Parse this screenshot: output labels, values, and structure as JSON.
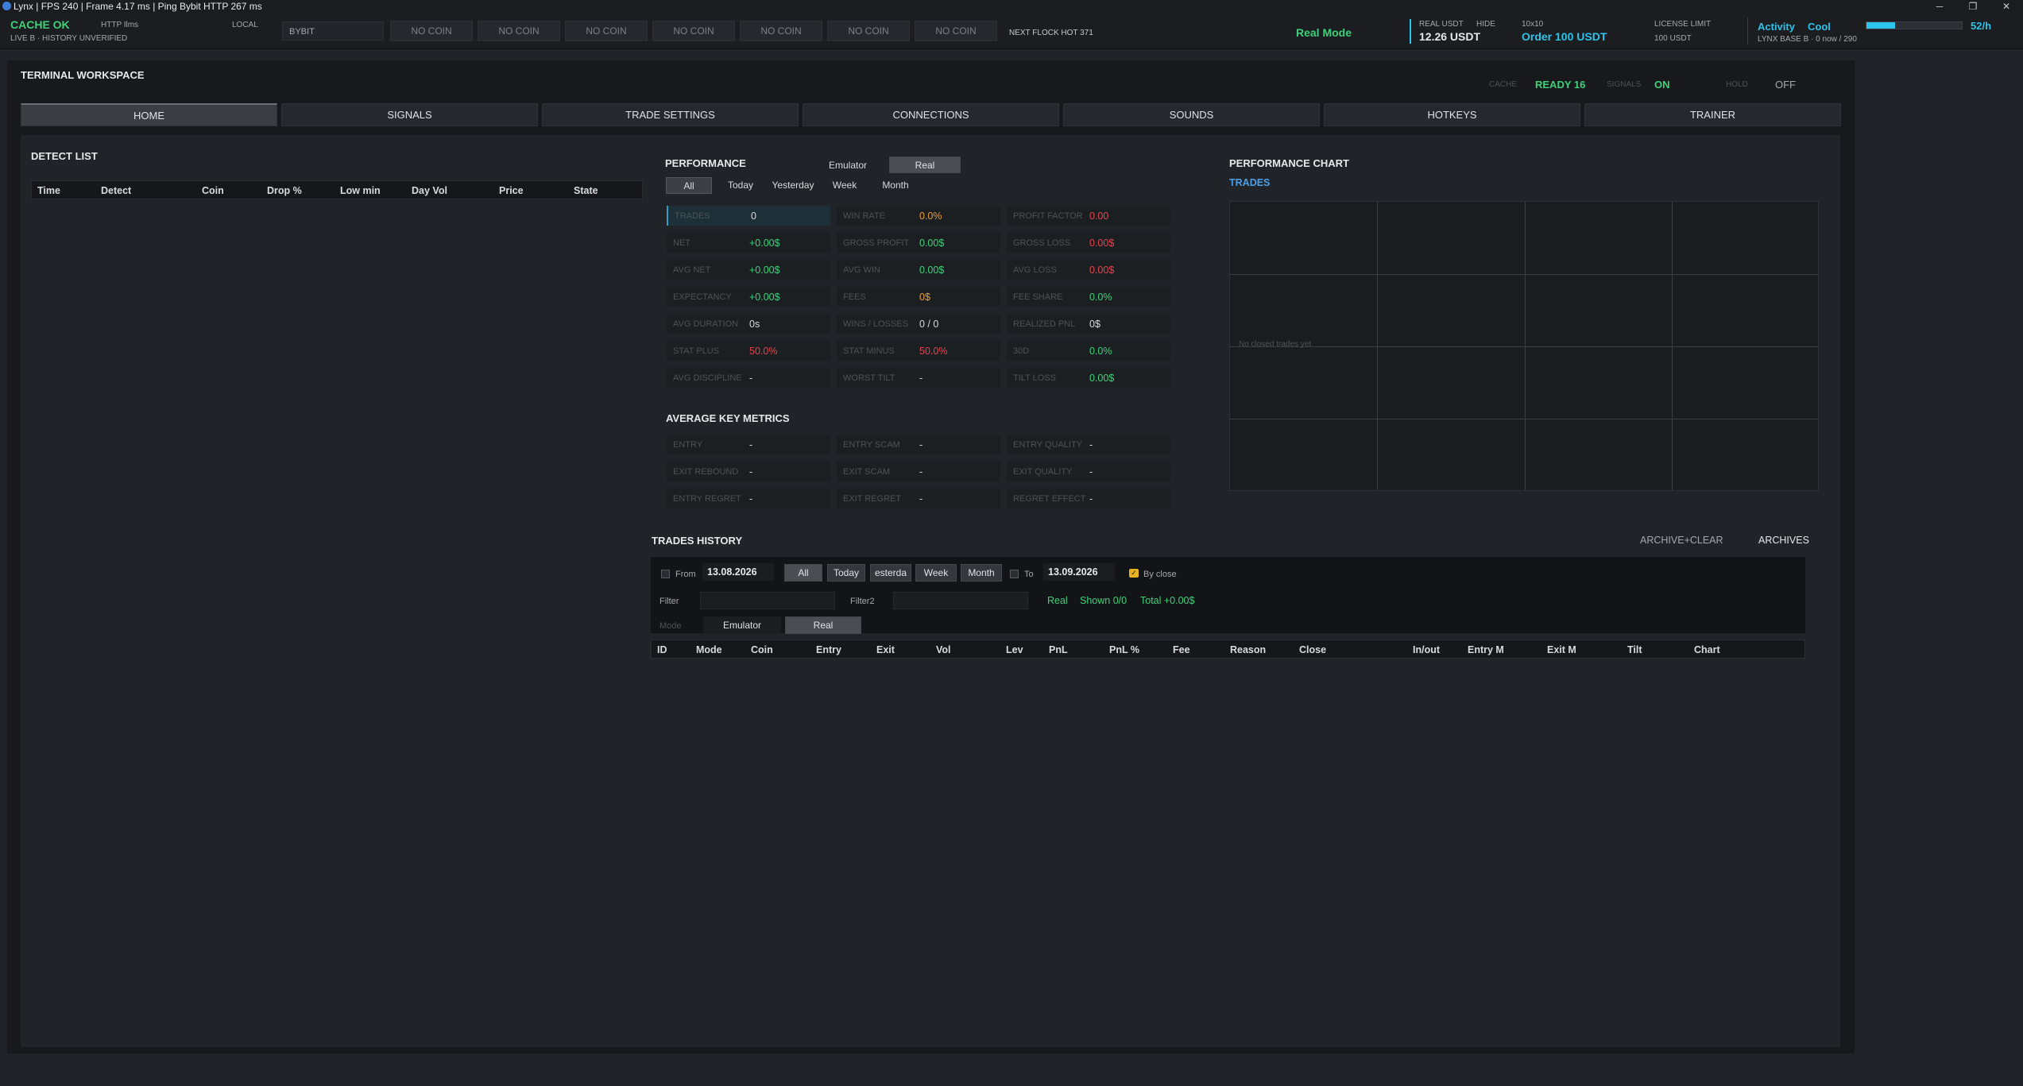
{
  "window": {
    "title": "Lynx | FPS 240 | Frame 4.17 ms | Ping Bybit HTTP 267 ms",
    "controls": [
      "─",
      "❐",
      "✕"
    ]
  },
  "status": {
    "cache_ok": "CACHE OK",
    "http": "HTTP Ilms",
    "local": "LOCAL",
    "history": "LIVE B · HISTORY UNVERIFIED",
    "exchange": "BYBIT",
    "coin_slots": [
      "NO COIN",
      "NO COIN",
      "NO COIN",
      "NO COIN",
      "NO COIN",
      "NO COIN",
      "NO COIN"
    ],
    "next_flock": "NEXT FLOCK HOT 371",
    "mode": "Real Mode",
    "real_usdt_label": "REAL USDT",
    "hide": "HIDE",
    "real_usdt_value": "12.26 USDT",
    "grid": "10x10",
    "order": "Order 100 USDT",
    "license_label": "LICENSE LIMIT",
    "license_value": "100 USDT",
    "activity_label": "Activity",
    "activity_state": "Cool",
    "activity_rate": "52/h",
    "activity_level": 0.3,
    "lynx_base": "LYNX BASE B · 0 now / 290"
  },
  "workspace": {
    "title": "TERMINAL WORKSPACE",
    "cache_label": "CACHE",
    "cache_value": "READY 16",
    "signals_label": "SIGNALS",
    "signals_value": "ON",
    "hold_label": "HOLD",
    "hold_value": "OFF",
    "tabs": [
      "HOME",
      "SIGNALS",
      "TRADE SETTINGS",
      "CONNECTIONS",
      "SOUNDS",
      "HOTKEYS",
      "TRAINER"
    ]
  },
  "detect": {
    "title": "DETECT LIST",
    "columns": [
      "Time",
      "Detect",
      "Coin",
      "Drop %",
      "Low min",
      "Day Vol",
      "Price",
      "State"
    ]
  },
  "performance": {
    "title": "PERFORMANCE",
    "mode_emulator": "Emulator",
    "mode_real": "Real",
    "periods": [
      "All",
      "Today",
      "Yesterday",
      "Week",
      "Month"
    ],
    "metrics": [
      {
        "label": "TRADES",
        "value": "0"
      },
      {
        "label": "WIN RATE",
        "value": "0.0%"
      },
      {
        "label": "PROFIT FACTOR",
        "value": "0.00"
      },
      {
        "label": "NET",
        "value": "+0.00$"
      },
      {
        "label": "GROSS PROFIT",
        "value": "0.00$"
      },
      {
        "label": "GROSS LOSS",
        "value": "0.00$"
      },
      {
        "label": "AVG NET",
        "value": "+0.00$"
      },
      {
        "label": "AVG WIN",
        "value": "0.00$"
      },
      {
        "label": "AVG LOSS",
        "value": "0.00$"
      },
      {
        "label": "EXPECTANCY",
        "value": "+0.00$"
      },
      {
        "label": "FEES",
        "value": "0$"
      },
      {
        "label": "FEE SHARE",
        "value": "0.0%"
      },
      {
        "label": "AVG DURATION",
        "value": "0s"
      },
      {
        "label": "WINS / LOSSES",
        "value": "0 / 0"
      },
      {
        "label": "REALIZED PNL",
        "value": "0$"
      },
      {
        "label": "STAT PLUS",
        "value": "50.0%"
      },
      {
        "label": "STAT MINUS",
        "value": "50.0%"
      },
      {
        "label": "30D",
        "value": "0.0%"
      },
      {
        "label": "AVG DISCIPLINE",
        "value": "-"
      },
      {
        "label": "WORST TILT",
        "value": "-"
      },
      {
        "label": "TILT LOSS",
        "value": "0.00$"
      }
    ],
    "key_metrics_title": "AVERAGE KEY METRICS",
    "key_metrics": [
      {
        "label": "ENTRY",
        "value": "-"
      },
      {
        "label": "ENTRY SCAM",
        "value": "-"
      },
      {
        "label": "ENTRY QUALITY",
        "value": "-"
      },
      {
        "label": "EXIT REBOUND",
        "value": "-"
      },
      {
        "label": "EXIT SCAM",
        "value": "-"
      },
      {
        "label": "EXIT QUALITY",
        "value": "-"
      },
      {
        "label": "ENTRY REGRET",
        "value": "-"
      },
      {
        "label": "EXIT REGRET",
        "value": "-"
      },
      {
        "label": "REGRET EFFECT",
        "value": "-"
      }
    ]
  },
  "perf_chart": {
    "title": "PERFORMANCE CHART",
    "subtitle": "TRADES",
    "empty": "No closed trades yet"
  },
  "history": {
    "title": "TRADES HISTORY",
    "archive_clear": "ARCHIVE+CLEAR",
    "archives": "ARCHIVES",
    "from_label": "From",
    "from_date": "13.08.2026",
    "periods": [
      "All",
      "Today",
      "esterda",
      "Week",
      "Month"
    ],
    "to_label": "To",
    "to_date": "13.09.2026",
    "by_close": "By close",
    "filter_label": "Filter",
    "filter2_label": "Filter2",
    "summary_mode": "Real",
    "summary_shown": "Shown 0/0",
    "summary_total": "Total +0.00$",
    "mode_label": "Mode",
    "mode_emulator": "Emulator",
    "mode_real": "Real",
    "columns": [
      "ID",
      "Mode",
      "Coin",
      "Entry",
      "Exit",
      "Vol",
      "Lev",
      "PnL",
      "PnL %",
      "Fee",
      "Reason",
      "Close",
      "In/out",
      "Entry M",
      "Exit M",
      "Tilt",
      "Chart"
    ]
  },
  "colors": {
    "green": "#3fd17a",
    "red": "#e2454f",
    "orange": "#e89e3b",
    "cyan": "#2ec3ea",
    "blue_link": "#4a9fe8"
  }
}
